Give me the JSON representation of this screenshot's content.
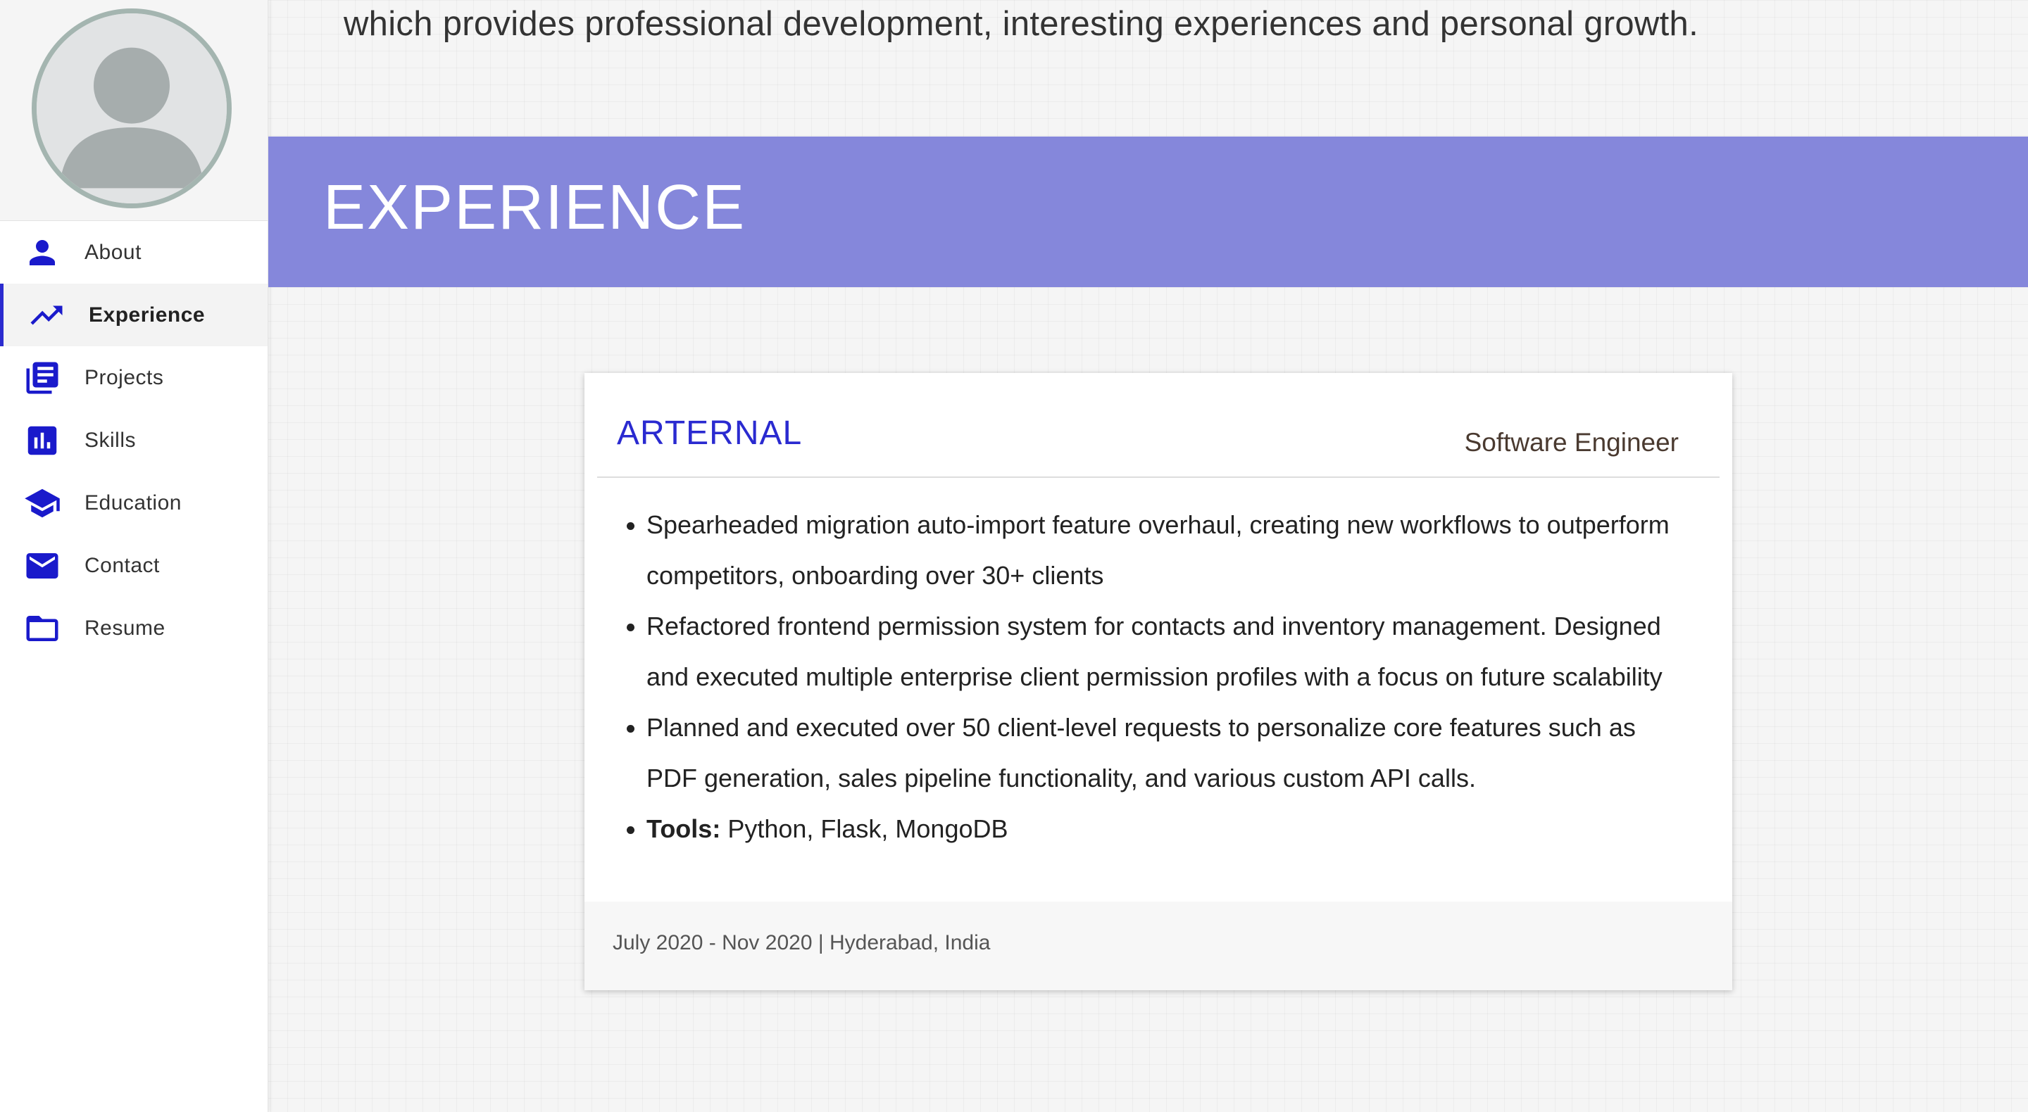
{
  "intro": {
    "text": "which provides professional development, interesting experiences and personal growth."
  },
  "sidebar": {
    "avatar_icon": "person-placeholder-icon",
    "items": [
      {
        "label": "About",
        "icon": "person-icon",
        "active": false
      },
      {
        "label": "Experience",
        "icon": "trending-up-icon",
        "active": true
      },
      {
        "label": "Projects",
        "icon": "library-books-icon",
        "active": false
      },
      {
        "label": "Skills",
        "icon": "bar-chart-icon",
        "active": false
      },
      {
        "label": "Education",
        "icon": "school-icon",
        "active": false
      },
      {
        "label": "Contact",
        "icon": "mail-icon",
        "active": false
      },
      {
        "label": "Resume",
        "icon": "folder-icon",
        "active": false
      }
    ]
  },
  "section": {
    "title": "EXPERIENCE"
  },
  "experience": [
    {
      "company": "ARTERNAL",
      "role": "Software Engineer",
      "bullets": [
        "Spearheaded migration auto-import feature overhaul, creating new workflows to outperform competitors, onboarding over 30+ clients",
        "Refactored frontend permission system for contacts and inventory management. Designed and executed multiple enterprise client permission profiles with a focus on future scalability",
        "Planned and executed over 50 client-level requests to personalize core features such as PDF generation, sales pipeline functionality, and various custom API calls."
      ],
      "tools_label": "Tools:",
      "tools": "Python, Flask, MongoDB",
      "footer": "July 2020 - Nov 2020 | Hyderabad, India"
    }
  ],
  "colors": {
    "accent": "#1a1acb",
    "banner": "#8587db",
    "company": "#2a2ad0"
  }
}
